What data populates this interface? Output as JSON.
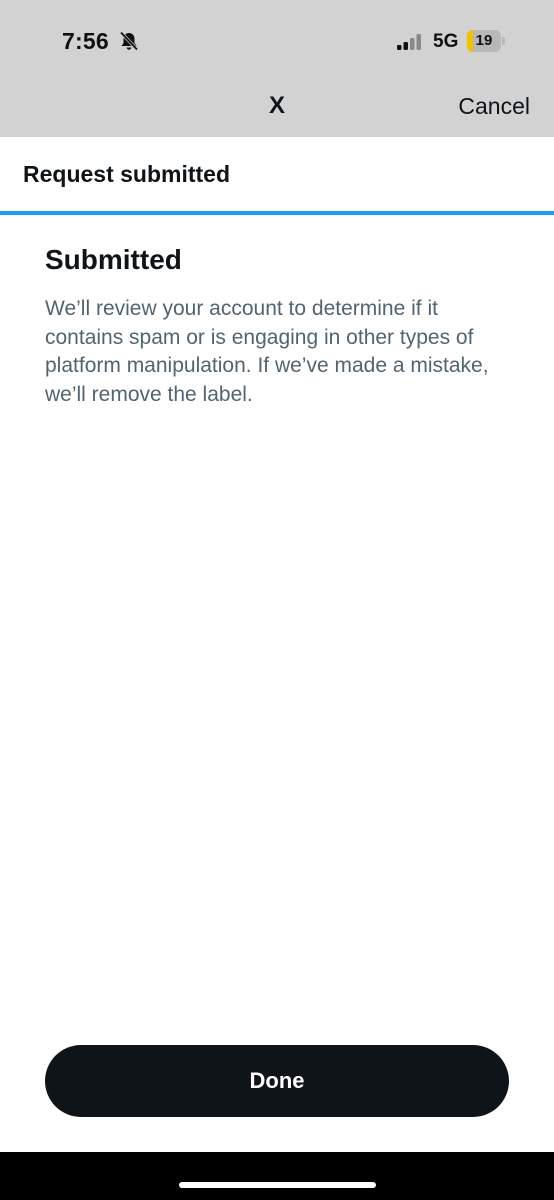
{
  "status_bar": {
    "time": "7:56",
    "network": "5G",
    "battery_level": "19",
    "battery_fraction": 0.19,
    "battery_color": "#f2c200",
    "icons": [
      "bell-slash-icon",
      "signal-icon",
      "battery-icon"
    ]
  },
  "nav": {
    "logo_text": "X",
    "cancel_label": "Cancel"
  },
  "header": {
    "title": "Request submitted",
    "progress_fraction": 1.0,
    "progress_color": "#1d9bf0"
  },
  "content": {
    "heading": "Submitted",
    "body": "We’ll review your account to determine if it contains spam or is engaging in other types of platform manipulation. If we’ve made a mistake, we’ll remove the label."
  },
  "footer": {
    "done_label": "Done"
  }
}
